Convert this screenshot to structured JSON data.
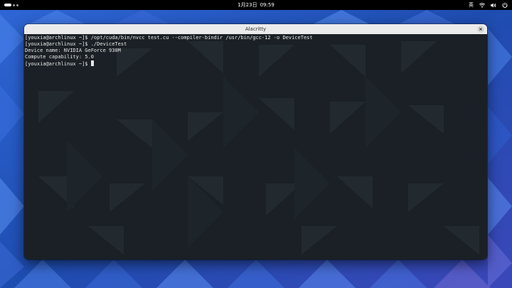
{
  "top_bar": {
    "clock": {
      "date": "1月23日",
      "time": "09:59"
    },
    "input_method": "英",
    "icons": [
      "activities-indicator-icon",
      "wifi-icon",
      "volume-icon",
      "power-icon"
    ]
  },
  "window": {
    "title": "Alacritty",
    "close_icon": "close-icon",
    "terminal": {
      "lines": [
        {
          "prompt": "[youxia@archlinux ~]$ ",
          "command": "/opt/cuda/bin/nvcc test.cu --compiler-bindir /usr/bin/gcc-12 -o DeviceTest"
        },
        {
          "prompt": "[youxia@archlinux ~]$ ",
          "command": "./DeviceTest"
        },
        {
          "output": "Device name: NVIDIA GeForce 930M"
        },
        {
          "output": "Compute capability: 5.0"
        },
        {
          "prompt": "[youxia@archlinux ~]$ ",
          "command": ""
        }
      ]
    }
  },
  "colors": {
    "wallpaper_base": "#1f4fb3",
    "terminal_bg": "#1a2025",
    "terminal_fg": "#e8e8e8",
    "titlebar_bg": "#ebebeb"
  }
}
